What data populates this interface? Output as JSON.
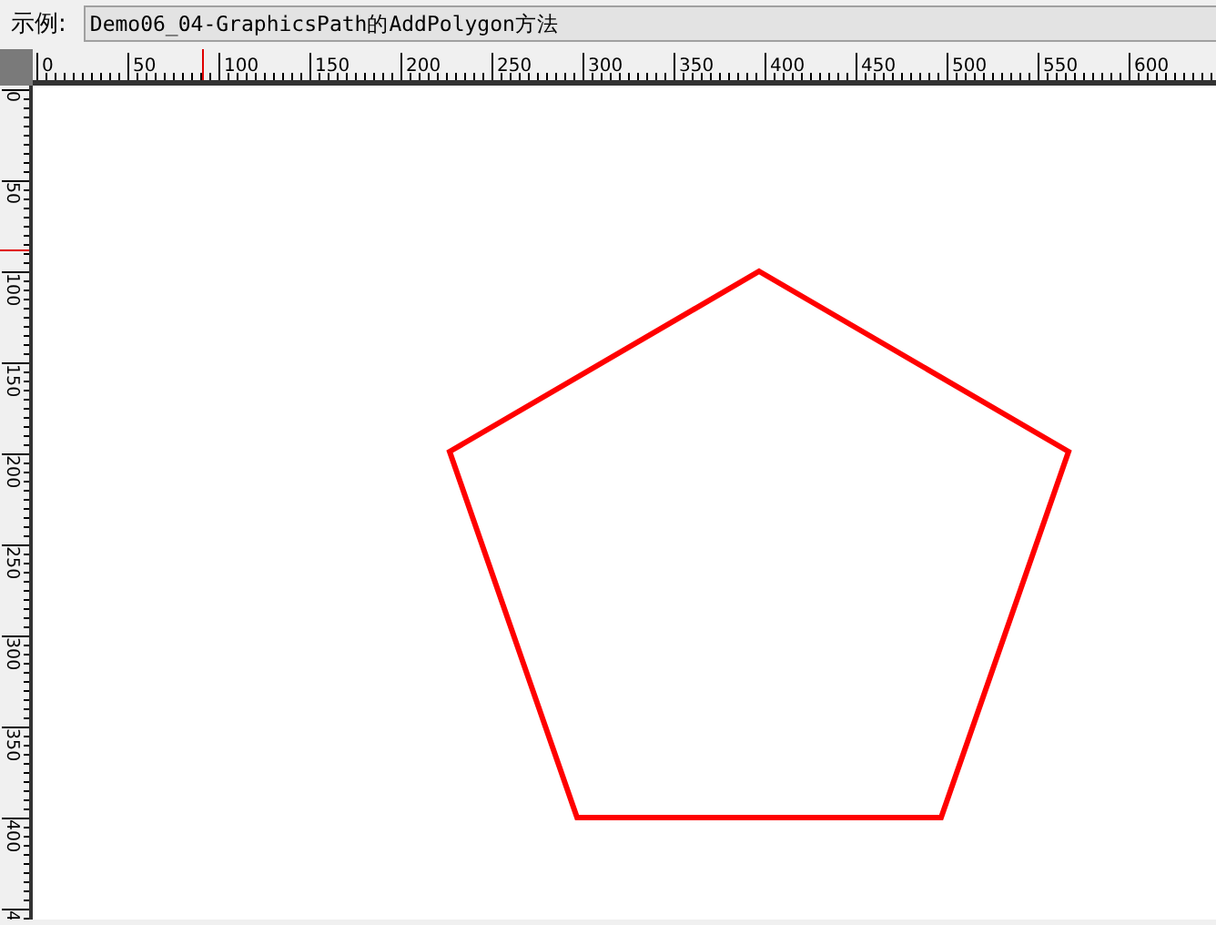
{
  "example_bar": {
    "label": "示例:",
    "value": "Demo06_04-GraphicsPath的AddPolygon方法"
  },
  "horizontal_ruler": {
    "labels": [
      "0",
      "50",
      "100",
      "150",
      "200",
      "250",
      "300",
      "350",
      "400",
      "450",
      "500",
      "550",
      "600"
    ]
  },
  "vertical_ruler": {
    "labels": [
      "0",
      "50",
      "100",
      "150",
      "200",
      "250",
      "300",
      "350",
      "400",
      "4"
    ]
  }
}
